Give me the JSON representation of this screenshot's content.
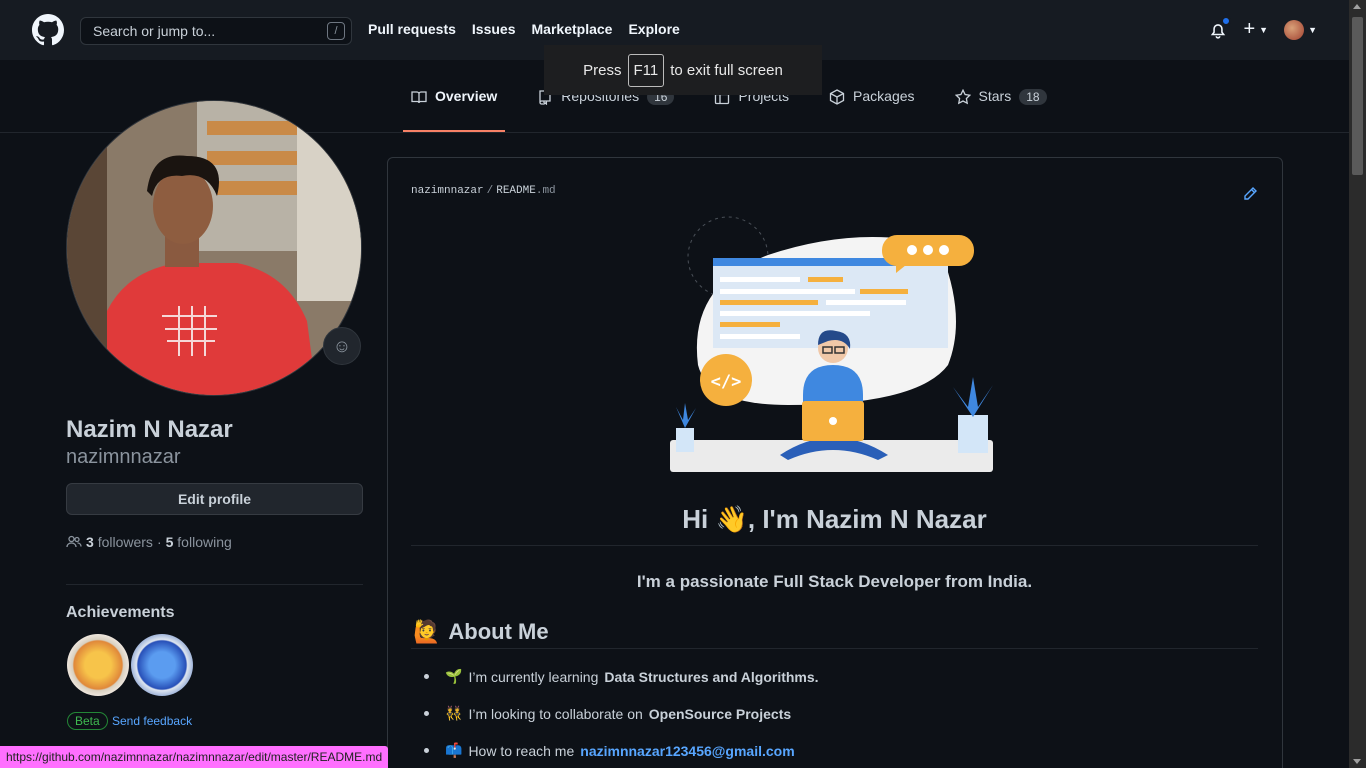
{
  "header": {
    "search_placeholder": "Search or jump to...",
    "search_kbd": "/",
    "nav": [
      "Pull requests",
      "Issues",
      "Marketplace",
      "Explore"
    ],
    "plus": "+"
  },
  "toast": {
    "press": "Press",
    "key": "F11",
    "rest": "to exit full screen"
  },
  "tabs": [
    {
      "label": "Overview",
      "icon": "book-icon",
      "active": true
    },
    {
      "label": "Repositories",
      "icon": "repo-icon",
      "count": "16"
    },
    {
      "label": "Projects",
      "icon": "table-icon"
    },
    {
      "label": "Packages",
      "icon": "package-icon"
    },
    {
      "label": "Stars",
      "icon": "star-icon",
      "count": "18"
    }
  ],
  "profile": {
    "name": "Nazim N Nazar",
    "login": "nazimnnazar",
    "edit_label": "Edit profile",
    "followers_count": "3",
    "followers_label": "followers",
    "dot": "·",
    "following_count": "5",
    "following_label": "following",
    "achievements_title": "Achievements",
    "beta": "Beta",
    "feedback": "Send feedback"
  },
  "readme": {
    "owner": "nazimnnazar",
    "sep": "/",
    "file_base": "README",
    "file_ext": ".md",
    "greeting": "Hi 👋, I'm Nazim N Nazar",
    "tagline": "I'm a passionate Full Stack Developer from India.",
    "about_emoji": "🙋",
    "about_title": "About Me",
    "items": [
      {
        "emoji": "🌱",
        "text": "I’m currently learning",
        "bold": "Data Structures and Algorithms."
      },
      {
        "emoji": "👯",
        "text": "I’m looking to collaborate on",
        "bold": "OpenSource Projects"
      },
      {
        "emoji": "📫",
        "text": "How to reach me",
        "link": "nazimnnazar123456@gmail.com"
      }
    ]
  },
  "status_url": "https://github.com/nazimnnazar/nazimnnazar/edit/master/README.md",
  "colors": {
    "accent_tab": "#f78166",
    "link": "#58a6ff",
    "beta": "#3fb950",
    "notification": "#1f6feb"
  }
}
